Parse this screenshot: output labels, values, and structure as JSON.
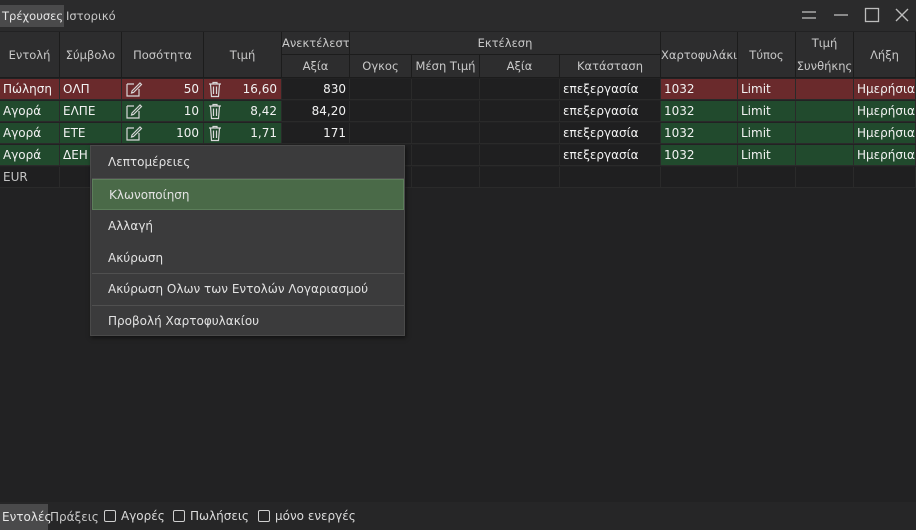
{
  "tabs": {
    "current": "Τρέχουσες",
    "history": "Ιστορικό"
  },
  "header": {
    "order": "Εντολή",
    "symbol": "Σύμβολο",
    "quantity": "Ποσότητα",
    "price": "Τιμή",
    "unexecuted": "Ανεκτέλεστη",
    "unexecuted_value": "Αξία",
    "execution": "Εκτέλεση",
    "volume": "Ογκος",
    "avg_price": "Μέση Τιμή",
    "exec_value": "Αξία",
    "status": "Κατάσταση",
    "portfolio": "Χαρτοφυλάκιο",
    "type": "Τύπος",
    "cond_price_1": "Τιμή",
    "cond_price_2": "Συνθήκης",
    "expiry": "Λήξη"
  },
  "rows": [
    {
      "side": "Πώληση",
      "symbol": "ΟΛΠ",
      "qty": "50",
      "price": "16,60",
      "value": "830",
      "status": "επεξεργασία",
      "portfolio": "1032",
      "type": "Limit",
      "expiry": "Ημερήσια"
    },
    {
      "side": "Αγορά",
      "symbol": "ΕΛΠΕ",
      "qty": "10",
      "price": "8,42",
      "value": "84,20",
      "status": "επεξεργασία",
      "portfolio": "1032",
      "type": "Limit",
      "expiry": "Ημερήσια"
    },
    {
      "side": "Αγορά",
      "symbol": "ΕΤΕ",
      "qty": "100",
      "price": "1,71",
      "value": "171",
      "status": "επεξεργασία",
      "portfolio": "1032",
      "type": "Limit",
      "expiry": "Ημερήσια"
    },
    {
      "side": "Αγορά",
      "symbol": "ΔΕΗ",
      "qty": "",
      "price": "",
      "value": "",
      "status": "επεξεργασία",
      "portfolio": "1032",
      "type": "Limit",
      "expiry": "Ημερήσια"
    }
  ],
  "total_row": {
    "currency": "EUR"
  },
  "context_menu": {
    "items": [
      "Λεπτομέρειες",
      "Κλωνοποίηση",
      "Αλλαγή",
      "Ακύρωση",
      "Ακύρωση Ολων των Εντολών Λογαριασμού",
      "Προβολή Χαρτοφυλακίου"
    ],
    "selected_index": 1
  },
  "bottom": {
    "orders_tab": "Εντολές",
    "trades_tab": "Πράξεις",
    "buys": "Αγορές",
    "sells": "Πωλήσεις",
    "active_only": "μόνο ενεργές"
  },
  "icons": {
    "edit": "edit-icon",
    "delete": "trash-icon"
  },
  "colors": {
    "sell_row": "#6a2a2c",
    "buy_row": "#214a2d",
    "menu_selected": "#4a6a48"
  }
}
